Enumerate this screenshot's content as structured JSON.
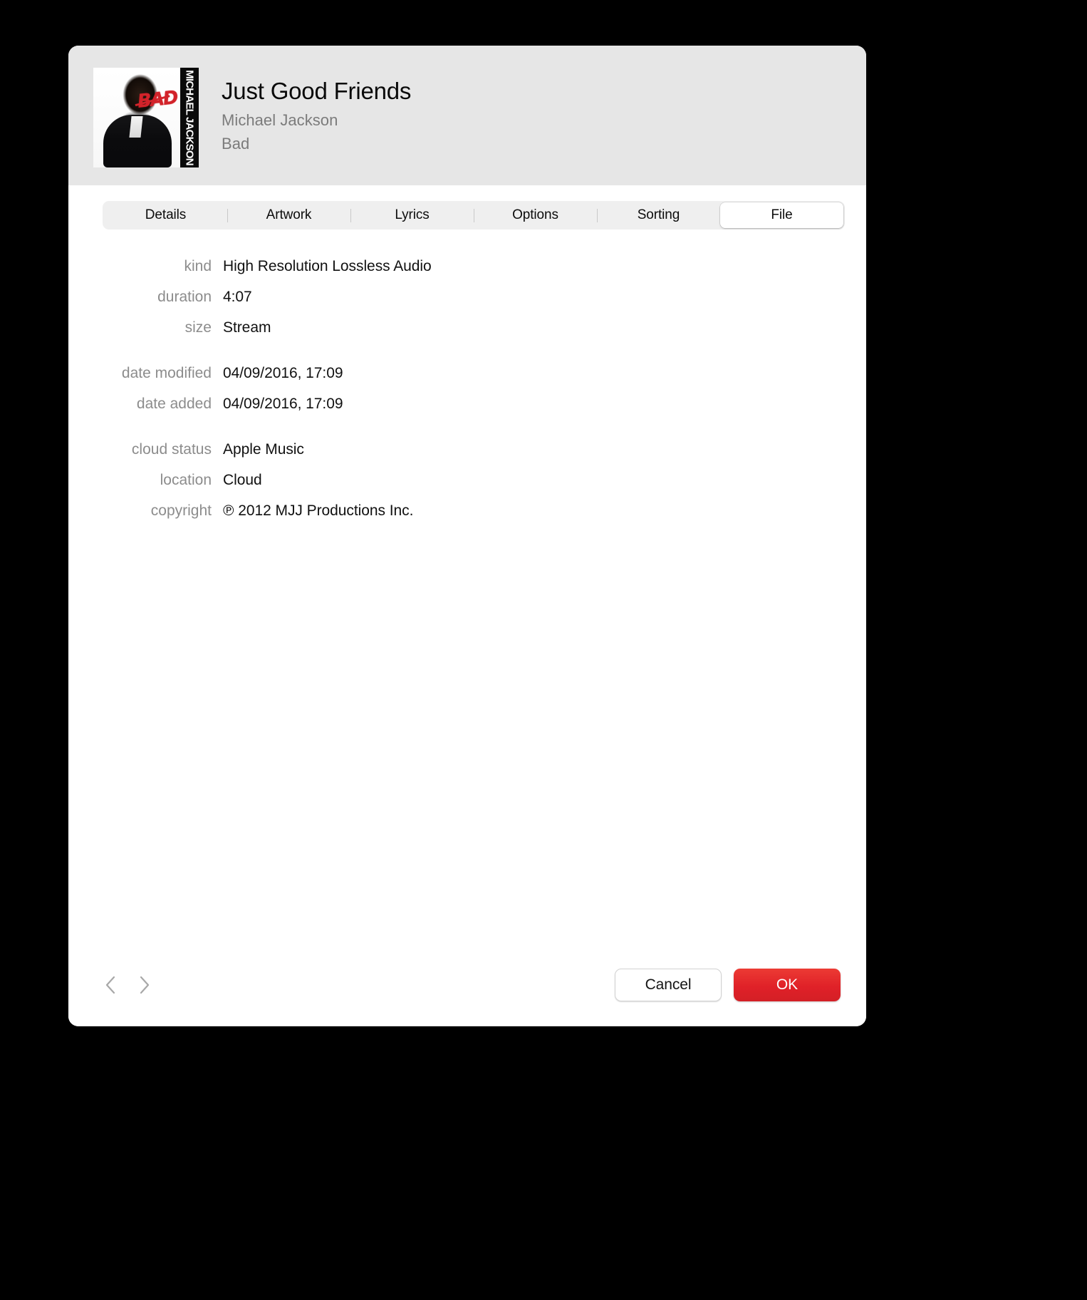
{
  "dialog": {
    "header": {
      "track_title": "Just Good Friends",
      "artist": "Michael Jackson",
      "album": "Bad",
      "artwork_alt": "Bad",
      "artwork_badge": "BAD",
      "artwork_spine": "MICHAEL JACKSON"
    },
    "tabs": [
      {
        "label": "Details",
        "selected": false
      },
      {
        "label": "Artwork",
        "selected": false
      },
      {
        "label": "Lyrics",
        "selected": false
      },
      {
        "label": "Options",
        "selected": false
      },
      {
        "label": "Sorting",
        "selected": false
      },
      {
        "label": "File",
        "selected": true
      }
    ],
    "fields": [
      {
        "label": "kind",
        "value": "High Resolution Lossless Audio"
      },
      {
        "label": "duration",
        "value": "4:07"
      },
      {
        "label": "size",
        "value": "Stream"
      },
      {
        "label": "date modified",
        "value": "04/09/2016, 17:09"
      },
      {
        "label": "date added",
        "value": "04/09/2016, 17:09"
      },
      {
        "label": "cloud status",
        "value": "Apple Music"
      },
      {
        "label": "location",
        "value": "Cloud"
      },
      {
        "label": "copyright",
        "value": "℗ 2012 MJJ Productions Inc."
      }
    ],
    "footer": {
      "previous_label": "Previous",
      "next_label": "Next",
      "cancel_label": "Cancel",
      "ok_label": "OK"
    },
    "colors": {
      "accent_ok": "#e02128",
      "header_background": "#e6e6e6",
      "label_text": "#8c8c8c",
      "value_text": "#111111",
      "tabbar_background": "#efefef"
    }
  }
}
